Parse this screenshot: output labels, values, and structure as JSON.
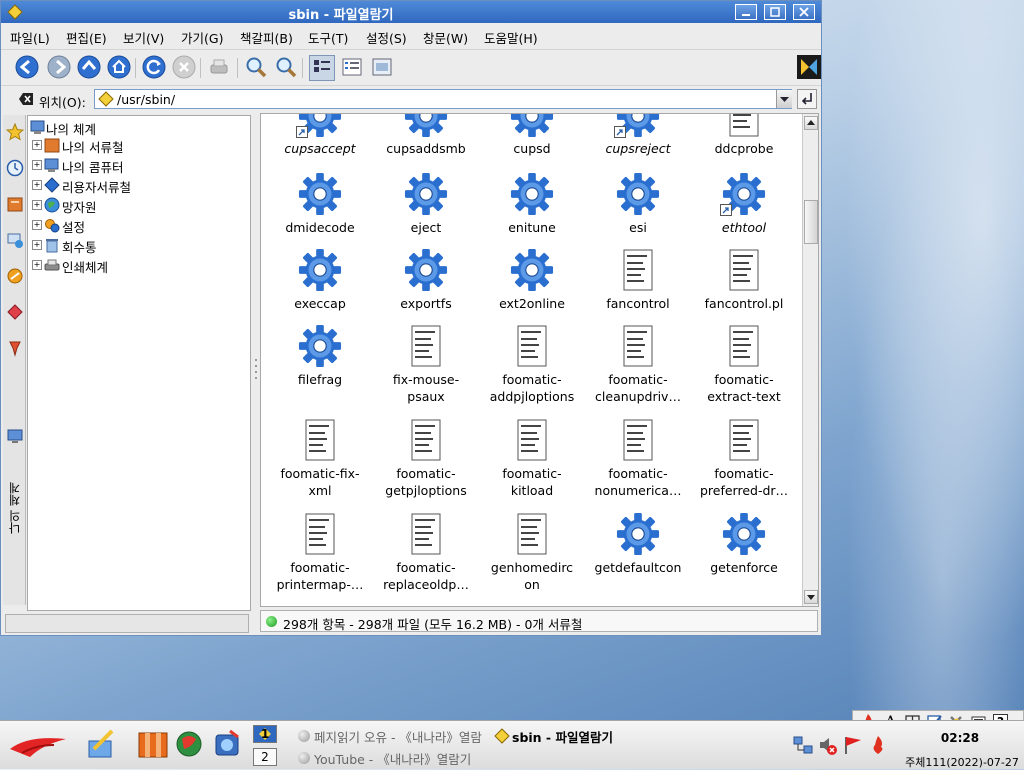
{
  "window": {
    "title": "sbin - 파일열람기"
  },
  "menu": [
    "파일(L)",
    "편집(E)",
    "보기(V)",
    "가기(G)",
    "책갈피(B)",
    "도구(T)",
    "설정(S)",
    "창문(W)",
    "도움말(H)"
  ],
  "location": {
    "label": "위치(O):",
    "value": "/usr/sbin/"
  },
  "side_panel": {
    "vertical_label": "나의 체계"
  },
  "tree": {
    "root": "나의 체계",
    "items": [
      "나의 서류철",
      "나의 콤퓨터",
      "리용자서류철",
      "망자원",
      "설정",
      "회수통",
      "인쇄체계"
    ]
  },
  "files": [
    {
      "name": "cupsaccept",
      "kind": "gear",
      "link": true,
      "italic": true
    },
    {
      "name": "cupsaddsmb",
      "kind": "gear",
      "link": false,
      "italic": false
    },
    {
      "name": "cupsd",
      "kind": "gear",
      "link": false,
      "italic": false
    },
    {
      "name": "cupsreject",
      "kind": "gear",
      "link": true,
      "italic": true
    },
    {
      "name": "ddcprobe",
      "kind": "script",
      "link": false,
      "italic": false
    },
    {
      "name": "dmidecode",
      "kind": "gear",
      "link": false,
      "italic": false
    },
    {
      "name": "eject",
      "kind": "gear",
      "link": false,
      "italic": false
    },
    {
      "name": "enitune",
      "kind": "gear",
      "link": false,
      "italic": false
    },
    {
      "name": "esi",
      "kind": "gear",
      "link": false,
      "italic": false
    },
    {
      "name": "ethtool",
      "kind": "gear",
      "link": true,
      "italic": true
    },
    {
      "name": "execcap",
      "kind": "gear",
      "link": false,
      "italic": false
    },
    {
      "name": "exportfs",
      "kind": "gear",
      "link": false,
      "italic": false
    },
    {
      "name": "ext2online",
      "kind": "gear",
      "link": false,
      "italic": false
    },
    {
      "name": "fancontrol",
      "kind": "script",
      "link": false,
      "italic": false
    },
    {
      "name": "fancontrol.pl",
      "kind": "script",
      "link": false,
      "italic": false
    },
    {
      "name": "filefrag",
      "kind": "gear",
      "link": false,
      "italic": false
    },
    {
      "name": "fix-mouse-\npsaux",
      "kind": "script",
      "link": false,
      "italic": false
    },
    {
      "name": "foomatic-\naddpjloptions",
      "kind": "script",
      "link": false,
      "italic": false
    },
    {
      "name": "foomatic-\ncleanupdriv…",
      "kind": "script",
      "link": false,
      "italic": false
    },
    {
      "name": "foomatic-\nextract-text",
      "kind": "script",
      "link": false,
      "italic": false
    },
    {
      "name": "foomatic-fix-\nxml",
      "kind": "script",
      "link": false,
      "italic": false
    },
    {
      "name": "foomatic-\ngetpjloptions",
      "kind": "script",
      "link": false,
      "italic": false
    },
    {
      "name": "foomatic-\nkitload",
      "kind": "script",
      "link": false,
      "italic": false
    },
    {
      "name": "foomatic-\nnonumerica…",
      "kind": "script",
      "link": false,
      "italic": false
    },
    {
      "name": "foomatic-\npreferred-dr…",
      "kind": "script",
      "link": false,
      "italic": false
    },
    {
      "name": "foomatic-\nprintermap-…",
      "kind": "script",
      "link": false,
      "italic": false
    },
    {
      "name": "foomatic-\nreplaceoldp…",
      "kind": "script",
      "link": false,
      "italic": false
    },
    {
      "name": "genhomedirc\non",
      "kind": "script",
      "link": false,
      "italic": false
    },
    {
      "name": "getdefaultcon",
      "kind": "gear",
      "link": false,
      "italic": false
    },
    {
      "name": "getenforce",
      "kind": "gear",
      "link": false,
      "italic": false
    }
  ],
  "status": {
    "text": "298개 항목 - 298개 파일 (모두 16.2 MB) - 0개 서류철"
  },
  "taskbar": {
    "pager": [
      "1",
      "2"
    ],
    "tasks": [
      {
        "label": "페지읽기 오유 - 《내나라》열람",
        "state": "muted"
      },
      {
        "label": "sbin - 파일열람기",
        "state": "active"
      },
      {
        "label": "YouTube - 《내나라》열람기",
        "state": "muted"
      }
    ],
    "clock_time": "02:28",
    "clock_date": "주체111(2022)-07-27"
  },
  "colors": {
    "title_bar": "#2f68bf",
    "gear_blue": "#2a6fd0",
    "desktop": "#7fa5cf"
  }
}
